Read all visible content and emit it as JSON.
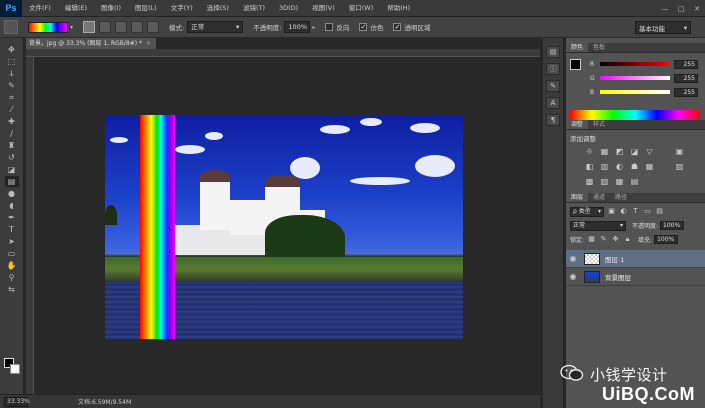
{
  "app": {
    "logo": "Ps"
  },
  "menu": [
    "文件(F)",
    "编辑(E)",
    "图像(I)",
    "图层(L)",
    "文字(Y)",
    "选择(S)",
    "滤镜(T)",
    "3D(D)",
    "视图(V)",
    "窗口(W)",
    "帮助(H)"
  ],
  "window_controls": {
    "minimize": "—",
    "restore": "□",
    "close": "✕"
  },
  "options": {
    "mode_label": "模式:",
    "mode_value": "正常",
    "opacity_label": "不透明度:",
    "opacity_value": "100%",
    "reverse_label": "反向",
    "dither_label": "仿色",
    "transparency_label": "透明区域",
    "reverse_checked": "",
    "dither_checked": "✓",
    "transparency_checked": "✓",
    "workspace": "基本功能"
  },
  "document": {
    "tab_title": "背景。jpg @ 33.3% (图层 1, RGB/8#) *",
    "tab_close": "×",
    "zoom": "33.33%",
    "doc_info": "文档:6.59M/9.54M"
  },
  "colors": {
    "foreground": "#000000",
    "background": "#ffffff",
    "gradient_stops": [
      "#ff0000",
      "#ff8800",
      "#ffff00",
      "#00ff00",
      "#00ffff",
      "#0000ff",
      "#8800ff",
      "#ff00ff"
    ]
  },
  "color_panel": {
    "tabs": [
      "颜色",
      "色板"
    ],
    "r_label": "R",
    "r_value": "255",
    "g_label": "G",
    "g_value": "255",
    "b_label": "B",
    "b_value": "255"
  },
  "adjust_panel": {
    "tabs": [
      "调整",
      "样式"
    ],
    "title": "添加调整",
    "icons": [
      "☼",
      "▦",
      "◩",
      "◪",
      "▽",
      "",
      "▣",
      "◧",
      "▥",
      "◐",
      "☗",
      "▦",
      "",
      "▨",
      "▩",
      "▧",
      "▦",
      "▤",
      "▩",
      ""
    ]
  },
  "layers_panel": {
    "tabs": [
      "图层",
      "通道",
      "路径"
    ],
    "kind_label": "ρ 类型",
    "blend_mode": "正常",
    "opacity_label": "不透明度:",
    "opacity_value": "100%",
    "lock_label": "锁定:",
    "fill_label": "填充:",
    "fill_value": "100%",
    "layers": [
      {
        "name": "图层 1",
        "selected": true
      },
      {
        "name": "背景图层",
        "selected": false
      }
    ]
  },
  "watermark": {
    "line1": "小钱学设计",
    "line2": "UiBQ.CoM"
  }
}
